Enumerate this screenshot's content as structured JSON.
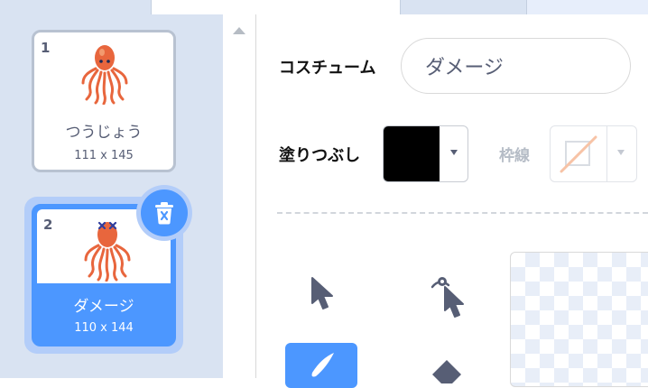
{
  "costumes": [
    {
      "number": "1",
      "name": "つうじょう",
      "size": "111 x 145",
      "selected": false
    },
    {
      "number": "2",
      "name": "ダメージ",
      "size": "110 x 144",
      "selected": true
    }
  ],
  "editor": {
    "costume_label": "コスチューム",
    "costume_name": "ダメージ",
    "fill_label": "塗りつぶし",
    "fill_color": "#000000",
    "outline_label": "枠線",
    "outline_color": "none"
  },
  "icons": {
    "delete": "trash-icon",
    "select": "select-arrow-icon",
    "reshape": "reshape-icon",
    "brush": "brush-icon",
    "eraser": "eraser-icon"
  },
  "colors": {
    "accent": "#4c97ff",
    "panel": "#d9e3f2",
    "sprite": "#e8663d"
  }
}
